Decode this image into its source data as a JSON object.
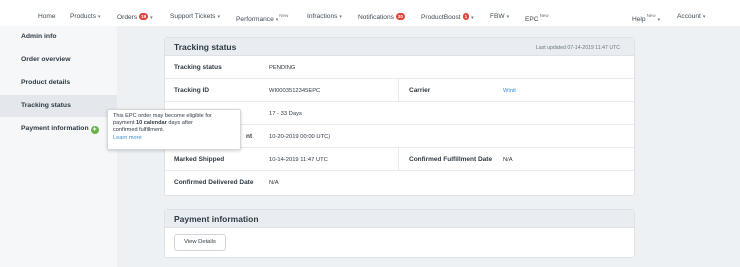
{
  "nav": {
    "home": "Home",
    "products": "Products",
    "orders": "Orders",
    "orders_badge": "19",
    "support_tickets": "Support Tickets",
    "performance": "Performance",
    "performance_sup": "New",
    "infractions": "Infractions",
    "notifications": "Notifications",
    "notifications_badge": "30",
    "productboost": "ProductBoost",
    "productboost_badge": "1",
    "fbw": "FBW",
    "epc": "EPC",
    "epc_sup": "New",
    "help": "Help",
    "help_sup": "New",
    "account": "Account"
  },
  "sidebar": {
    "items": [
      {
        "label": "Admin info"
      },
      {
        "label": "Order overview"
      },
      {
        "label": "Product details"
      },
      {
        "label": "Tracking status"
      },
      {
        "label": "Payment information"
      }
    ]
  },
  "tracking": {
    "title": "Tracking status",
    "last_updated": "Last updated 07-14-2019 11:47 UTC",
    "rows": {
      "status_label": "Tracking status",
      "status_value": "PENDING",
      "id_label": "Tracking ID",
      "id_value": "WI0003512345EPC",
      "carrier_label": "Carrier",
      "carrier_value": "Winit",
      "days_value": "17 - 33 Days",
      "deadline_label_tail": "nt",
      "deadline_value": "10-20-2019 00:00 UTC)",
      "shipped_label": "Marked Shipped",
      "shipped_value": "10-14-2019 11:47 UTC",
      "confirmed_label": "Confirmed Fulfillment Date",
      "confirmed_value": "N/A",
      "delivered_label": "Confirmed Delivered Date",
      "delivered_value": "N/A"
    }
  },
  "payment": {
    "title": "Payment information",
    "button": "View Details"
  },
  "tooltip": {
    "line1": "This EPC order may become eligible for",
    "line2_pre": "payment ",
    "line2_bold": "10 calendar",
    "line2_post": " days after",
    "line3": "confirmed fulfillment.",
    "link": "Learn more"
  },
  "colors": {
    "badge": "#e0443a",
    "link": "#3a8fd6",
    "gear": "#6ab04c"
  }
}
